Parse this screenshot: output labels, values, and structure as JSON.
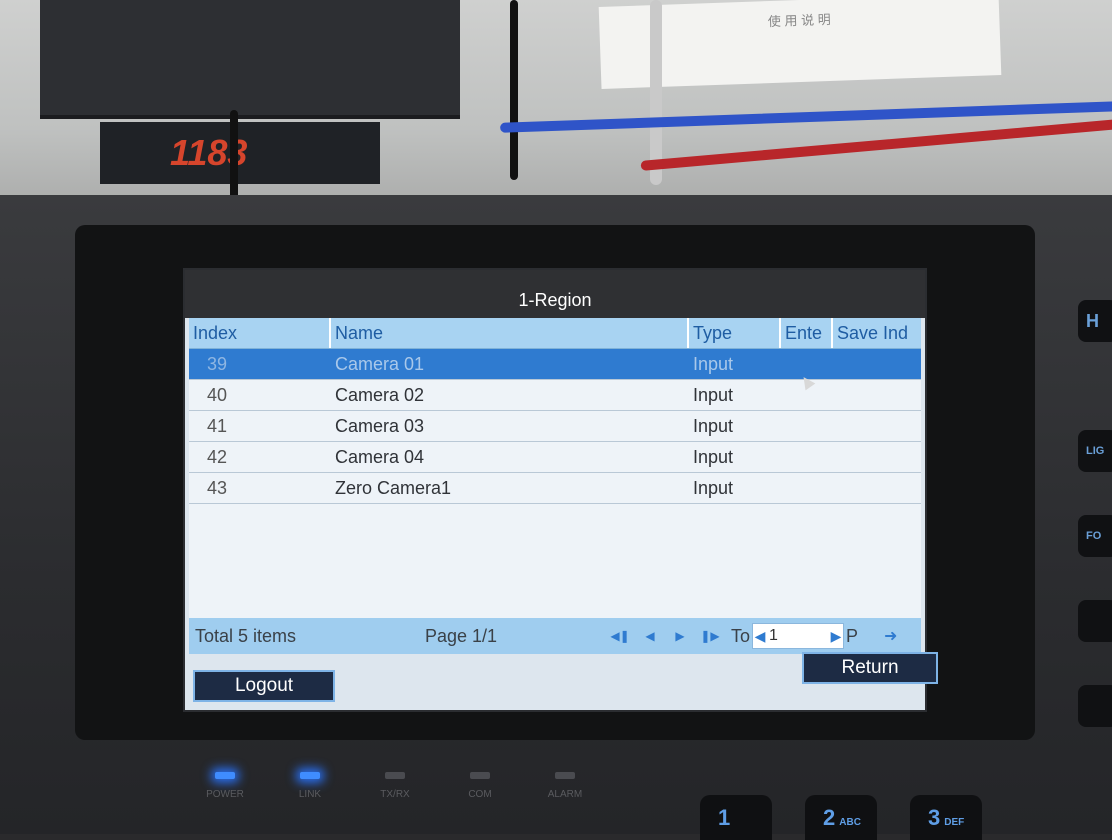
{
  "environment": {
    "device_label": "1183",
    "paper_text": "使 用 说 明",
    "leds": [
      {
        "label": "POWER",
        "on": true
      },
      {
        "label": "LINK",
        "on": true
      },
      {
        "label": "TX/RX",
        "on": false
      },
      {
        "label": "COM",
        "on": false
      },
      {
        "label": "ALARM",
        "on": false
      }
    ],
    "keys": [
      {
        "label": "1",
        "sub": ""
      },
      {
        "label": "2",
        "sub": "ABC"
      },
      {
        "label": "3",
        "sub": "DEF"
      }
    ],
    "side_buttons": [
      "LIG",
      "FO"
    ],
    "side_logo": "H"
  },
  "screen": {
    "title": "1-Region",
    "columns": {
      "index": "Index",
      "name": "Name",
      "type": "Type",
      "enter": "Ente",
      "save": "Save Ind"
    },
    "rows": [
      {
        "index": "39",
        "name": "Camera 01",
        "type": "Input"
      },
      {
        "index": "40",
        "name": "Camera 02",
        "type": "Input"
      },
      {
        "index": "41",
        "name": "Camera 03",
        "type": "Input"
      },
      {
        "index": "42",
        "name": "Camera 04",
        "type": "Input"
      },
      {
        "index": "43",
        "name": "Zero Camera1",
        "type": "Input"
      }
    ],
    "selected_row": 0,
    "footer": {
      "total": "Total 5 items",
      "page": "Page 1/1",
      "to_label": "To",
      "page_input_value": "1",
      "p_label": "P"
    },
    "buttons": {
      "return": "Return",
      "logout": "Logout"
    },
    "colors": {
      "header_bg": "#a8d3f2",
      "selected_row": "#2f7bd0",
      "title_bar": "#2f3033"
    }
  }
}
